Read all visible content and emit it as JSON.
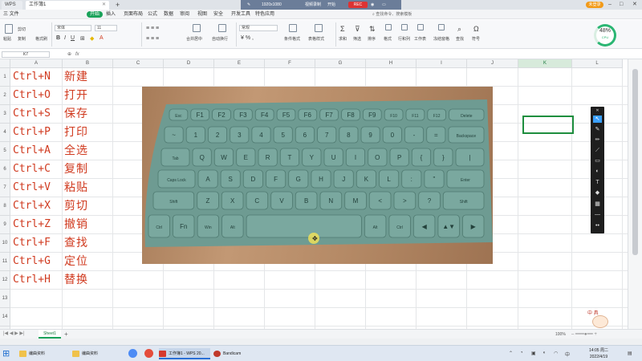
{
  "titlebar": {
    "tabs": [
      {
        "label": "WPS"
      },
      {
        "label": "工作簿1"
      }
    ],
    "plus": "+",
    "recorder": {
      "resolution": "1920x1080",
      "mode": "视频录制",
      "start": "开始",
      "rec": "REC"
    },
    "login": "未登录",
    "minimize": "–",
    "maximize": "□",
    "close": "✕"
  },
  "menubar": {
    "items": [
      "三 文件",
      "开始",
      "插入",
      "页面布局",
      "公式",
      "数据",
      "审阅",
      "视图",
      "安全",
      "开发工具",
      "特色应用"
    ],
    "active": "开始",
    "search": "查找命令、搜索模板"
  },
  "ribbon": {
    "paste": "粘贴",
    "cut": "剪切",
    "copy": "复制",
    "format_painter": "格式刷",
    "font_name": "宋体",
    "font_size": "11",
    "number_format": "常规",
    "merge_center": "合并居中",
    "wrap_text": "自动换行",
    "conditional_format": "条件格式",
    "table_style": "表格样式",
    "sum": "求和",
    "filter": "筛选",
    "sort": "排序",
    "format": "格式",
    "row_col": "行和列",
    "worksheet": "工作表",
    "freeze": "冻结窗格",
    "find": "查找",
    "symbol": "符号",
    "cpu_percent": "48%",
    "cpu_label": "CPU"
  },
  "formula_bar": {
    "name_box": "K7",
    "fx": "fx",
    "value": ""
  },
  "grid": {
    "columns": [
      "A",
      "B",
      "C",
      "D",
      "E",
      "F",
      "G",
      "H",
      "I",
      "J",
      "K",
      "L"
    ],
    "selected_column": "K",
    "rows": [
      "1",
      "2",
      "3",
      "4",
      "5",
      "6",
      "7",
      "8",
      "9",
      "10",
      "11",
      "12",
      "13",
      "14",
      "15"
    ],
    "shortcuts": [
      {
        "keys": "Ctrl+N",
        "action": "新建"
      },
      {
        "keys": "Ctrl+O",
        "action": "打开"
      },
      {
        "keys": "Ctrl+S",
        "action": "保存"
      },
      {
        "keys": "Ctrl+P",
        "action": "打印"
      },
      {
        "keys": "Ctrl+A",
        "action": "全选"
      },
      {
        "keys": "Ctrl+C",
        "action": "复制"
      },
      {
        "keys": "Ctrl+V",
        "action": "粘贴"
      },
      {
        "keys": "Ctrl+X",
        "action": "剪切"
      },
      {
        "keys": "Ctrl+Z",
        "action": "撤销"
      },
      {
        "keys": "Ctrl+F",
        "action": "查找"
      },
      {
        "keys": "Ctrl+G",
        "action": "定位"
      },
      {
        "keys": "Ctrl+H",
        "action": "替换"
      }
    ],
    "text_color": "#d03a1f"
  },
  "keyboard": {
    "color": "#6e9b92",
    "rows": [
      [
        "Esc",
        "F1",
        "F2",
        "F3",
        "F4",
        "F5",
        "F6",
        "F7",
        "F8",
        "F9",
        "F10",
        "F11",
        "F12",
        "Delete"
      ],
      [
        "~",
        "1",
        "2",
        "3",
        "4",
        "5",
        "6",
        "7",
        "8",
        "9",
        "0",
        "-",
        "=",
        "Backspace"
      ],
      [
        "Tab",
        "Q",
        "W",
        "E",
        "R",
        "T",
        "Y",
        "U",
        "I",
        "O",
        "P",
        "{",
        "}",
        "|"
      ],
      [
        "Caps Lock",
        "A",
        "S",
        "D",
        "F",
        "G",
        "H",
        "J",
        "K",
        "L",
        ":",
        "\"",
        "Enter"
      ],
      [
        "Shift",
        "Z",
        "X",
        "C",
        "V",
        "B",
        "N",
        "M",
        "<",
        ">",
        "?",
        "Shift"
      ],
      [
        "Ctrl",
        "Fn",
        "Win",
        "Alt",
        "",
        "Alt",
        "Ctrl",
        "◀",
        "▲▼",
        "▶"
      ]
    ]
  },
  "draw_toolbar": {
    "tools": [
      "pointer-icon",
      "pen-icon",
      "pencil-icon",
      "brush-icon",
      "line-icon",
      "highlighter-icon",
      "text-icon",
      "eraser-icon",
      "pattern-icon",
      "minus-icon",
      "more-icon"
    ],
    "close": "✕"
  },
  "sheets": {
    "tabs": [
      "Sheet1"
    ],
    "add": "+"
  },
  "status": {
    "zoom": "100%"
  },
  "sticker": "中 具",
  "taskbar": {
    "apps": [
      {
        "label": "编曲资料",
        "color": "#f0c24b"
      },
      {
        "label": "编曲资料",
        "color": "#f0c24b"
      },
      {
        "label": "",
        "color": "#4c8bf5"
      },
      {
        "label": "",
        "color": "#e44c3c"
      },
      {
        "label": "工作簿1 - WPS 20...",
        "color": "#d63a2f"
      },
      {
        "label": "Bandicam",
        "color": "#c0392b"
      }
    ],
    "time": "14:05 周二",
    "date": "2022/4/19"
  }
}
